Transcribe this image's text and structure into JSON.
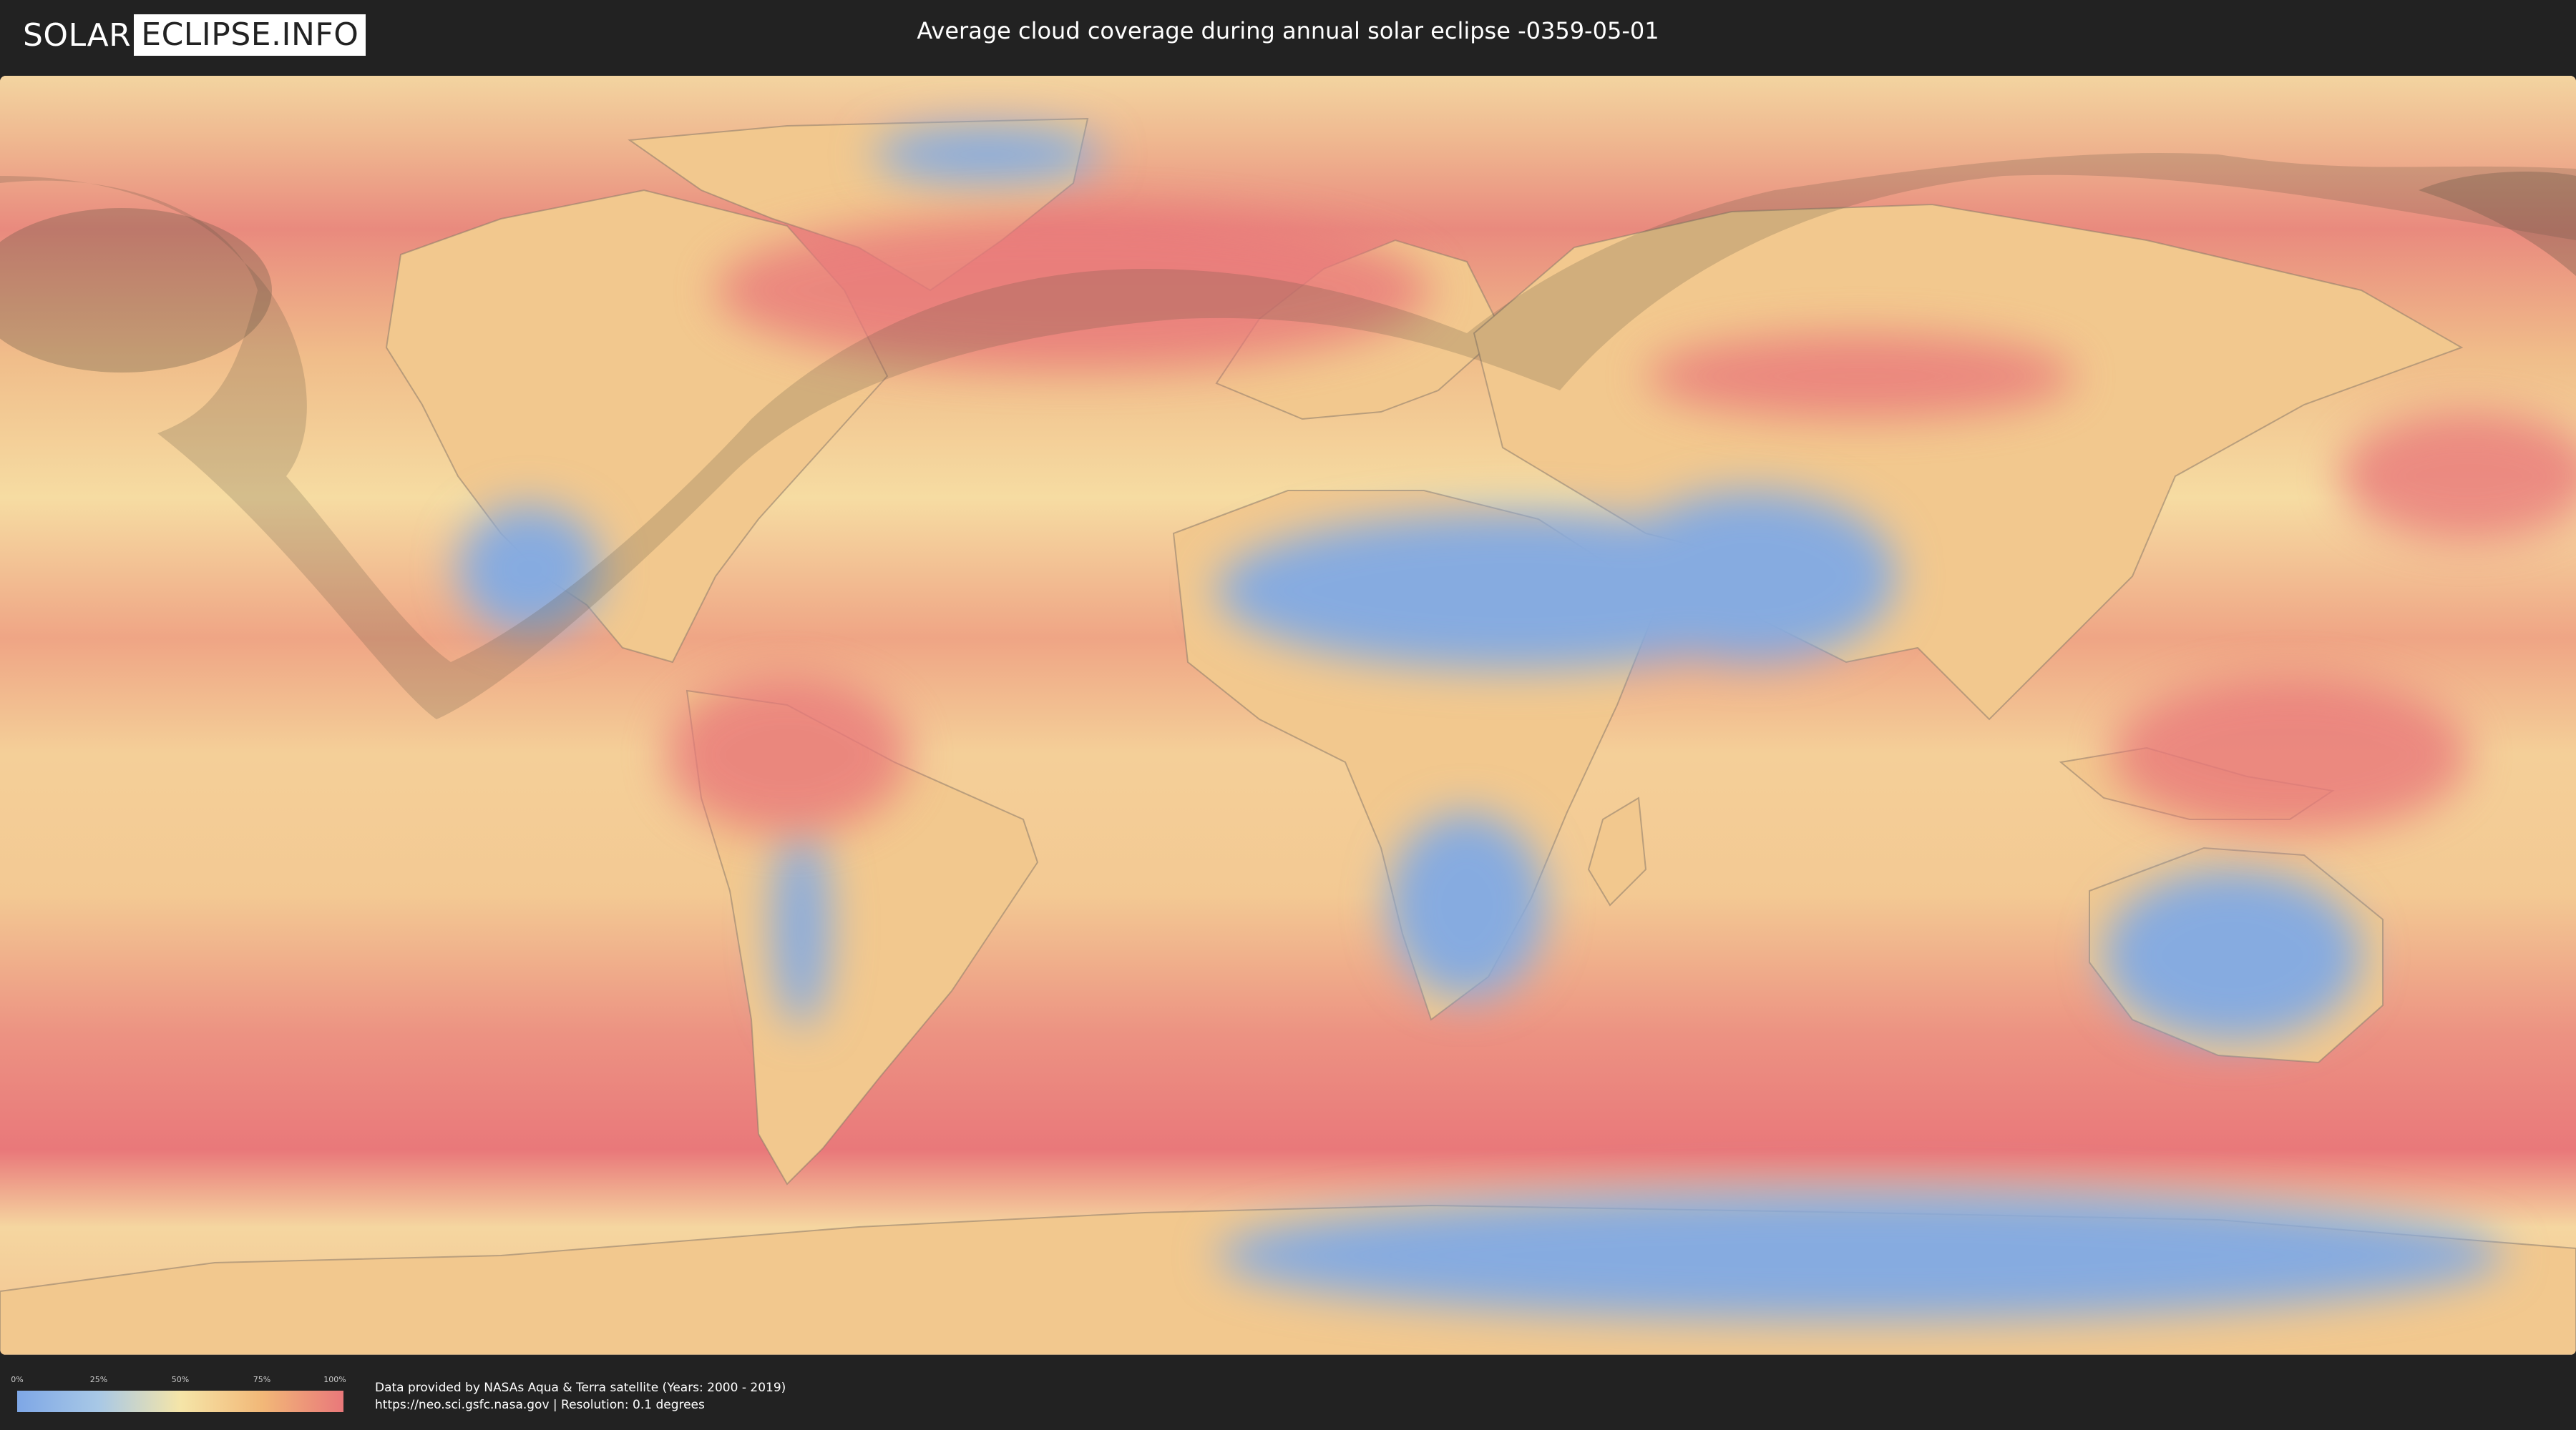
{
  "header": {
    "logo_part1": "SOLAR",
    "logo_part2": "ECLIPSE.INFO",
    "title": "Average cloud coverage during annual solar eclipse -0359-05-01"
  },
  "legend": {
    "ticks": [
      "0%",
      "25%",
      "50%",
      "75%",
      "100%"
    ],
    "colors": [
      "#7ea7e6",
      "#a8c8e6",
      "#f5e5a8",
      "#f2b878",
      "#e9787a"
    ]
  },
  "footer": {
    "credit_line1": "Data provided by NASAs Aqua & Terra satellite (Years: 2000 - 2019)",
    "credit_line2": "https://neo.sci.gsfc.nasa.gov | Resolution: 0.1 degrees"
  },
  "map": {
    "ocean_color": "#ef9a7e",
    "clear_sky_color": "#86abe0",
    "eclipse_shadow_color": "#5a5040"
  }
}
